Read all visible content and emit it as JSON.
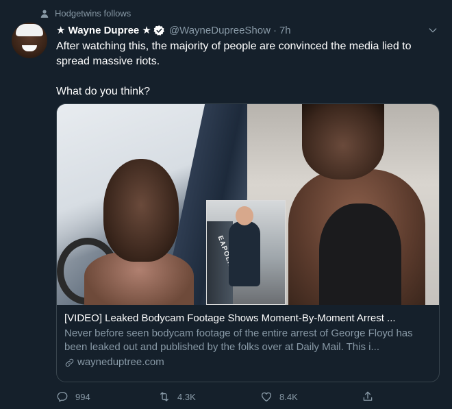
{
  "social_context": {
    "text": "Hodgetwins follows"
  },
  "tweet": {
    "display_name": "★ Wayne Dupree ★",
    "handle": "@WayneDupreeShow",
    "separator": "·",
    "time": "7h",
    "text_line1": "After watching this, the majority of people are convinced the media lied to spread massive riots.",
    "text_line2": "What do you think?"
  },
  "card": {
    "inset_car_text": "EAPOLIS",
    "title": "[VIDEO] Leaked Bodycam Footage Shows Moment-By-Moment Arrest ...",
    "description": "Never before seen bodycam footage of the entire arrest of George Floyd has been leaked out and published by the folks over at Daily Mail. This i...",
    "domain": "wayneduptree.com"
  },
  "actions": {
    "replies": "994",
    "retweets": "4.3K",
    "likes": "8.4K"
  },
  "colors": {
    "background": "#15202b",
    "secondary_text": "#8899a6",
    "border": "#38444d",
    "verified": "#ffffff"
  },
  "icons": [
    "person-icon",
    "verified-badge-icon",
    "chevron-down-icon",
    "link-icon",
    "reply-icon",
    "retweet-icon",
    "like-icon",
    "share-icon"
  ]
}
